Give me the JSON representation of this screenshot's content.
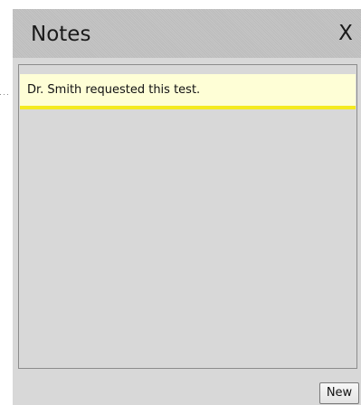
{
  "panel": {
    "title": "Notes",
    "close_label": "X"
  },
  "notes": [
    {
      "text": "Dr. Smith requested this test."
    }
  ],
  "footer": {
    "new_label": "New"
  },
  "colors": {
    "panel_background": "#d8d8d8",
    "header_background": "#c2c2c2",
    "note_background": "#fefed6",
    "note_accent": "#f4ea20"
  }
}
